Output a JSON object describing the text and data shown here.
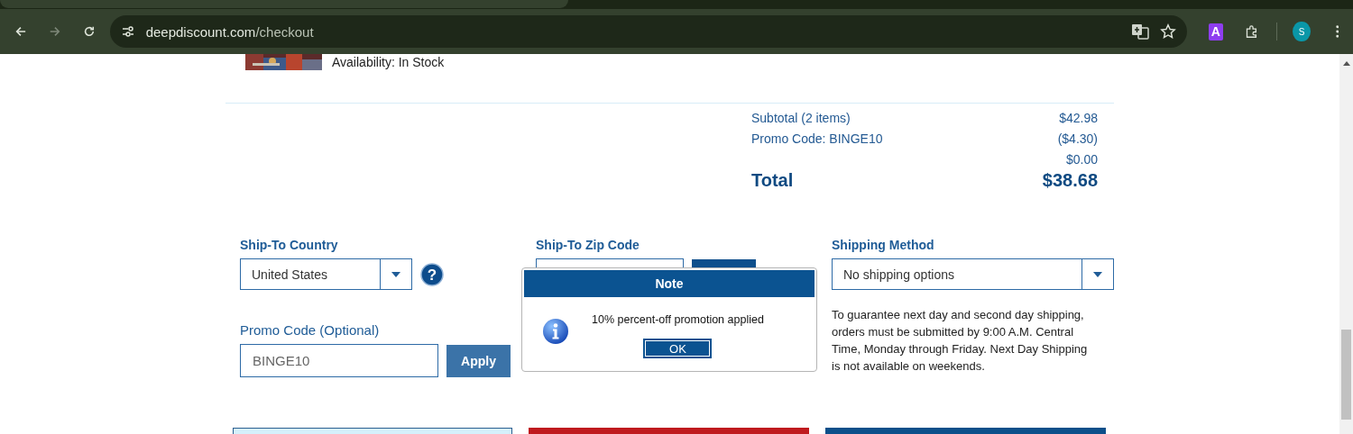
{
  "browser": {
    "url_host": "deepdiscount.com",
    "url_path": "/checkout",
    "profile_initial": "S",
    "extension_letter": "A"
  },
  "product": {
    "availability": "Availability: In Stock"
  },
  "summary": [
    {
      "label": "Subtotal (2 items)",
      "amount": "$42.98"
    },
    {
      "label": "Promo Code: BINGE10",
      "amount": "($4.30)"
    },
    {
      "amount": "$0.00"
    }
  ],
  "total": {
    "label": "Total",
    "amount": "$38.68"
  },
  "ship_country": {
    "label": "Ship-To Country",
    "value": "United States",
    "help_glyph": "?"
  },
  "ship_zip": {
    "label": "Ship-To Zip Code"
  },
  "shipping_method": {
    "label": "Shipping Method",
    "value": "No shipping options",
    "note": "To guarantee next day and second day shipping, orders must be submitted by 9:00 A.M. Central Time, Monday through Friday. Next Day Shipping is not available on weekends."
  },
  "promo": {
    "label": "Promo Code (Optional)",
    "value": "BINGE10",
    "button": "Apply"
  },
  "dialog": {
    "title": "Note",
    "message": "10% percent-off promotion applied",
    "button": "OK"
  },
  "bottom_panels": [
    {
      "color": "#d5f0fb"
    },
    {
      "color": "#bf1a1e"
    },
    {
      "color": "#0c4f8a"
    }
  ]
}
